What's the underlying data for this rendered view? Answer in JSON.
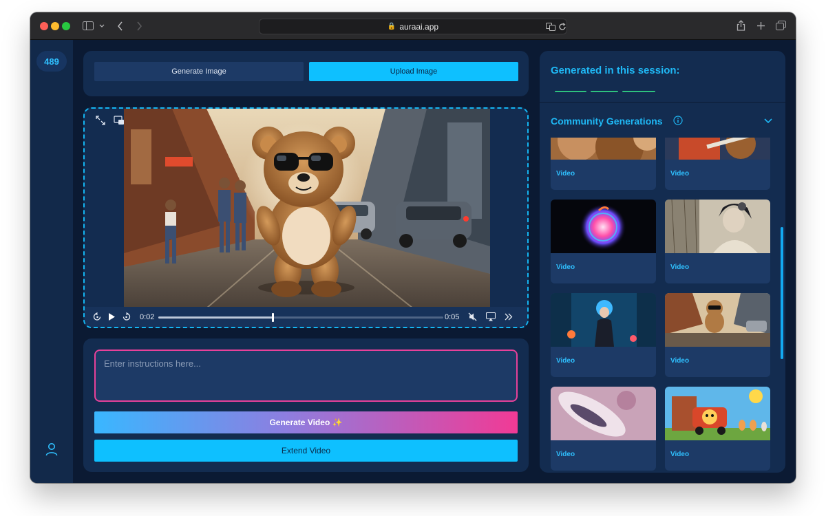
{
  "browser": {
    "url": "auraai.app",
    "back_icon": "chevron-left-icon",
    "forward_icon": "chevron-right-icon",
    "sidebar_icon": "sidebar-icon",
    "share_icon": "share-icon",
    "new_tab_icon": "plus-icon",
    "tabs_icon": "tabs-icon",
    "translate_icon": "translate-icon",
    "reload_icon": "reload-icon"
  },
  "sidebar": {
    "credits": "489",
    "user_icon": "user-icon"
  },
  "mode_tabs": {
    "generate_label": "Generate Image",
    "upload_label": "Upload Image",
    "active": "Upload Image"
  },
  "video": {
    "current_time": "0:02",
    "duration": "0:05",
    "progress": 0.4,
    "expand_icon": "expand-icon",
    "pip_icon": "picture-in-picture-icon",
    "rewind_icon": "rewind-icon",
    "play_icon": "play-icon",
    "forward_icon": "fast-forward-icon",
    "mute_icon": "muted-icon",
    "airplay_icon": "airplay-icon",
    "more_icon": "double-chevron-right-icon"
  },
  "prompt": {
    "placeholder": "Enter instructions here...",
    "value": ""
  },
  "actions": {
    "generate_video_label": "Generate Video ✨",
    "extend_video_label": "Extend Video"
  },
  "session": {
    "title": "Generated in this session:"
  },
  "community": {
    "title": "Community Generations",
    "items": [
      {
        "label": "Video",
        "thumb": "bear-fur-closeup"
      },
      {
        "label": "Video",
        "thumb": "bear-guitar"
      },
      {
        "label": "Video",
        "thumb": "neon-apple-logo"
      },
      {
        "label": "Video",
        "thumb": "fantasy-queen"
      },
      {
        "label": "Video",
        "thumb": "underwater-girl"
      },
      {
        "label": "Video",
        "thumb": "teddy-bear-street"
      },
      {
        "label": "Video",
        "thumb": "galaxy-swirl"
      },
      {
        "label": "Video",
        "thumb": "cartoon-train"
      }
    ]
  },
  "colors": {
    "accent": "#0ec0ff",
    "panel": "#132c50",
    "background": "#0b1a33",
    "prompt_border": "#e8419a"
  }
}
